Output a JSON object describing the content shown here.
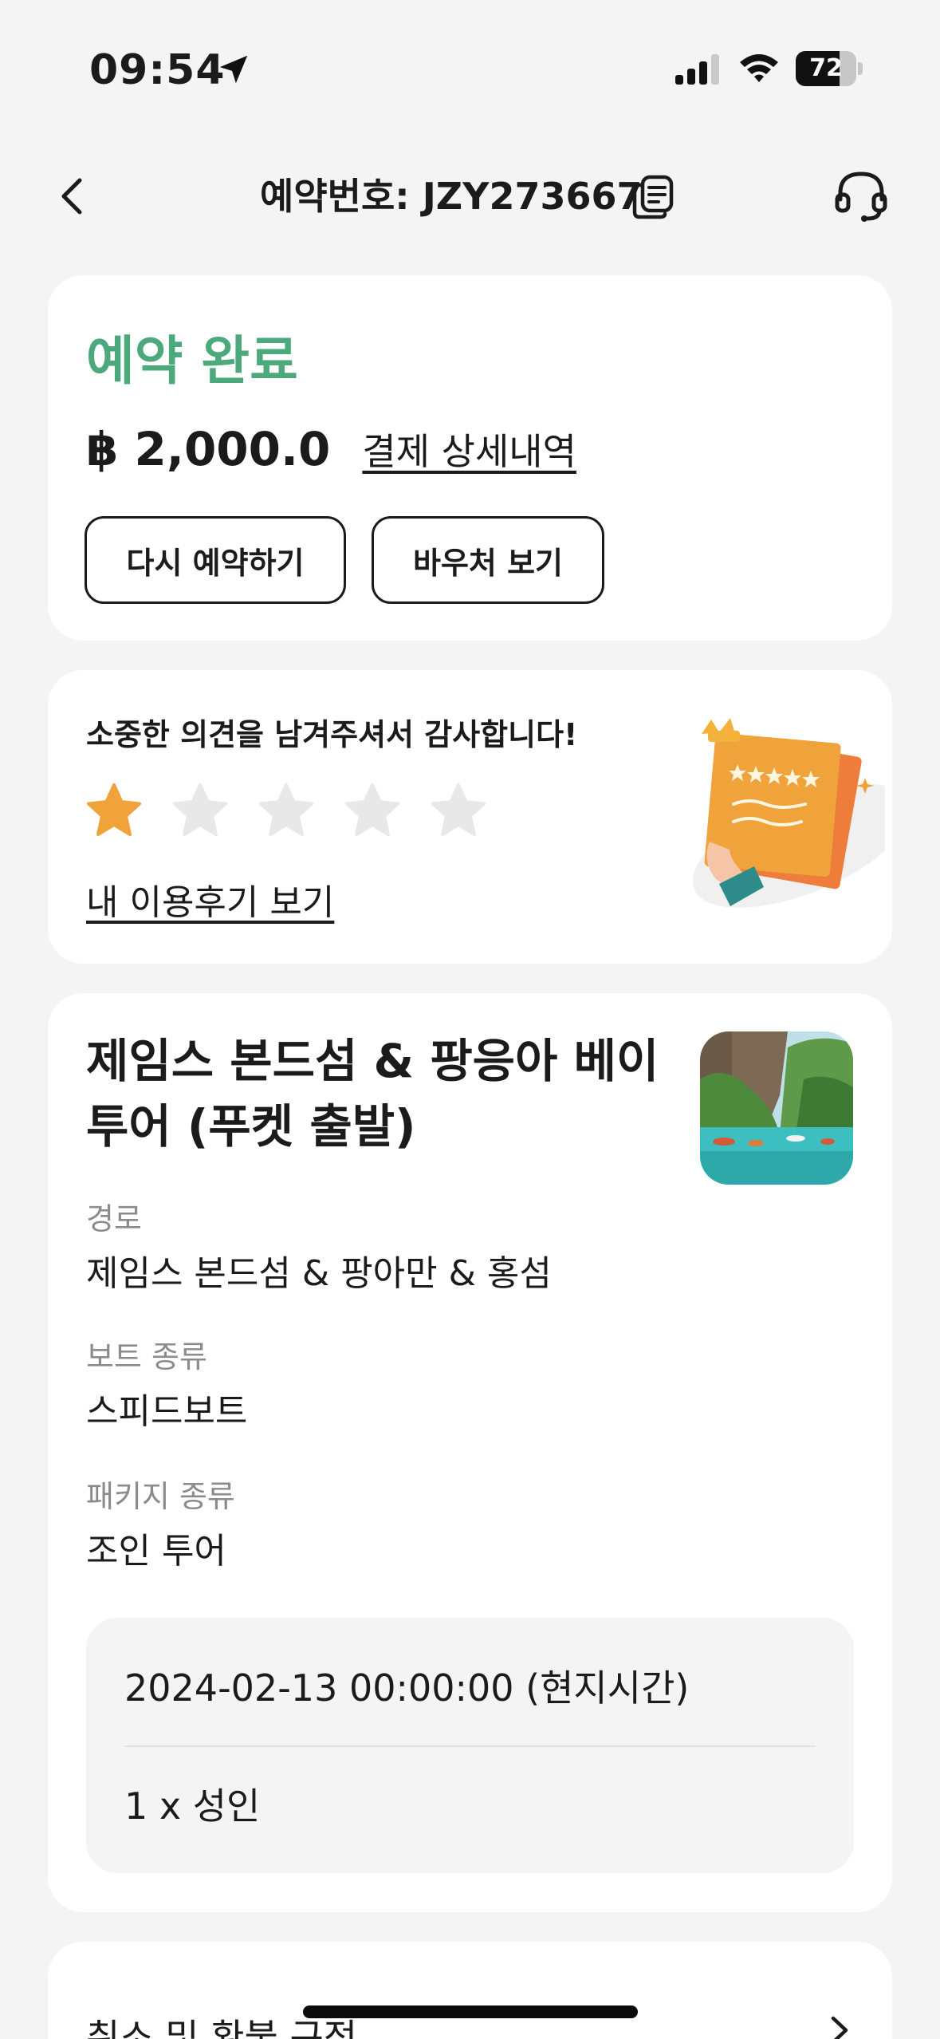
{
  "status_bar": {
    "time": "09:54",
    "battery_level": 72,
    "icons": [
      "location-arrow-icon",
      "cellular-signal-icon",
      "wifi-icon",
      "battery-icon"
    ]
  },
  "header": {
    "title": "예약번호: JZY273667",
    "icons": [
      "back-chevron-icon",
      "copy-icon",
      "headset-icon"
    ]
  },
  "booking_status": {
    "status": "예약 완료",
    "status_color": "#4ba97c",
    "price": "฿ 2,000.0",
    "payment_detail_link": "결제 상세내역",
    "rebook_button": "다시 예약하기",
    "voucher_button": "바우처 보기"
  },
  "review": {
    "thanks_text": "소중한 의견을 남겨주셔서 감사합니다!",
    "rating": 1,
    "max_rating": 5,
    "star_active_color": "#f0a23b",
    "star_inactive_color": "#e8e8e8",
    "view_review_link": "내 이용후기 보기"
  },
  "tour": {
    "title": "제임스 본드섬 & 팡응아 베이 투어 (푸켓 출발)",
    "fields": [
      {
        "label": "경로",
        "value": "제임스 본드섬 & 팡아만 & 홍섬"
      },
      {
        "label": "보트 종류",
        "value": "스피드보트"
      },
      {
        "label": "패키지 종류",
        "value": "조인 투어"
      }
    ],
    "date": "2024-02-13 00:00:00 (현지시간)",
    "quantity": "1 x 성인"
  },
  "refund": {
    "label": "취소 및 환불 규정"
  }
}
